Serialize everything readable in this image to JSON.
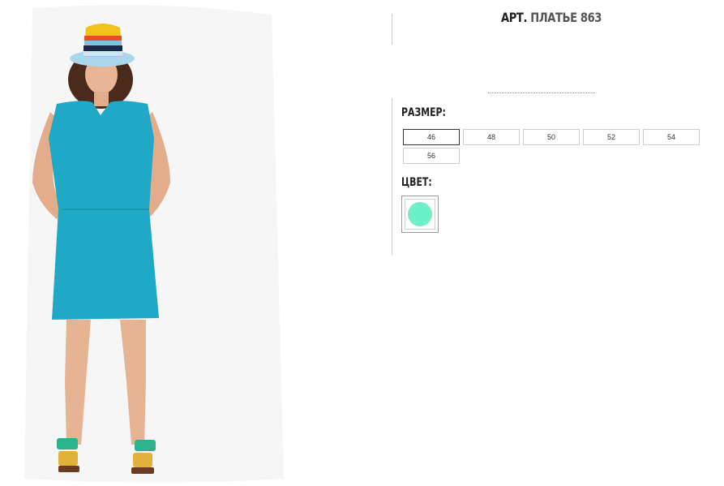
{
  "product": {
    "title_prefix": "АРТ.",
    "title_name": "ПЛАТЬЕ 863"
  },
  "size": {
    "label": "РАЗМЕР:",
    "options": [
      "46",
      "48",
      "50",
      "52",
      "54",
      "56"
    ],
    "selected": "46"
  },
  "color": {
    "label": "ЦВЕТ:",
    "swatch_color": "#6cf2c8"
  },
  "photo": {
    "dress_color": "#1fa9c7"
  }
}
